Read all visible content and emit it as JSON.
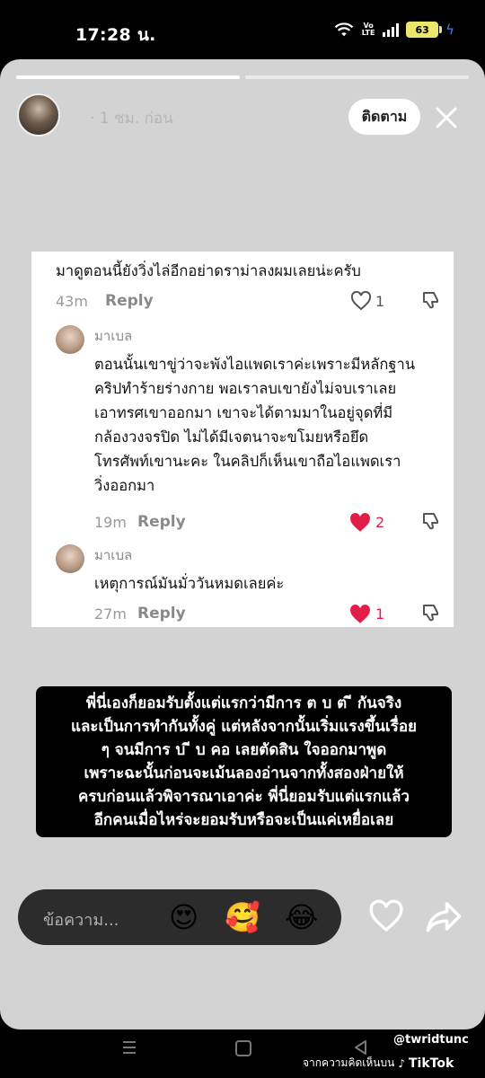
{
  "status_bar": {
    "time": "17:28 น.",
    "network": "Vo LTE",
    "battery": "63"
  },
  "story": {
    "progress": [
      1.0,
      0.0
    ],
    "time_ago": "· 1 ชม. ก่อน",
    "follow_label": "ติดตาม",
    "comments": {
      "top": {
        "text": "มาดูตอนนี้ยังวิ่งไล่อีกอย่าดราม่าลงผมเลยน่ะครับ",
        "time": "43m",
        "reply": "Reply",
        "likes": "1"
      },
      "reply1": {
        "name": "มาเบล",
        "lines": [
          "ตอนนั้นเขาขู่ว่าจะพังไอแพดเราค่ะเพราะมีหลักฐาน",
          "คริปทำร้ายร่างกาย พอเราลบเขายังไม่จบเราเลย",
          "เอาทรศเขาออกมา เขาจะได้ตามมาในอยู่จุดที่มี",
          "กล้องวงจรปิด ไม่ได้มีเจตนาจะขโมยหรือยึด",
          "โทรศัพท์เขานะคะ ในคลิปก็เห็นเขาถือไอแพดเรา",
          "วิ่งออกมา"
        ],
        "time": "19m",
        "reply": "Reply",
        "likes": "2"
      },
      "reply2": {
        "name": "มาเบล",
        "text": "เหตุการณ์มันมั่ววันหมดเลยค่ะ",
        "time": "27m",
        "reply": "Reply",
        "likes": "1"
      }
    },
    "caption": [
      "พี่นี่เองก็ยอมรับตั้งแต่แรกว่ามีการ ต บ ต ี กันจริง",
      "และเป็นการทำกันทั้งคู่ แต่หลังจากนั้นเริ่มแรงขึ้นเรื่อย",
      "ๆ จนมีการ บ ี บ คอ เลยตัดสิน ใจออกมาพูด",
      "เพราะฉะนั้นก่อนจะเม้นลองอ่านจากทั้งสองฝ่ายให้",
      "ครบก่อนแล้วพิจารณาเอาค่ะ พี่นี่ยอมรับแต่แรกแล้ว",
      "อีกคนเมื่อไหร่จะยอมรับหรือจะเป็นแค่เหยื่อเลย"
    ]
  },
  "message_bar": {
    "placeholder": "ข้อความ...",
    "emojis": [
      "😍",
      "🥰",
      "😂"
    ]
  },
  "watermark": {
    "handle": "@twridtunc",
    "line": "จากความคิดเห็นบน",
    "brand": "TikTok"
  },
  "colors": {
    "liked_heart": "#e11d48",
    "battery": "#e9e86a",
    "charging": "#3b82f6"
  }
}
